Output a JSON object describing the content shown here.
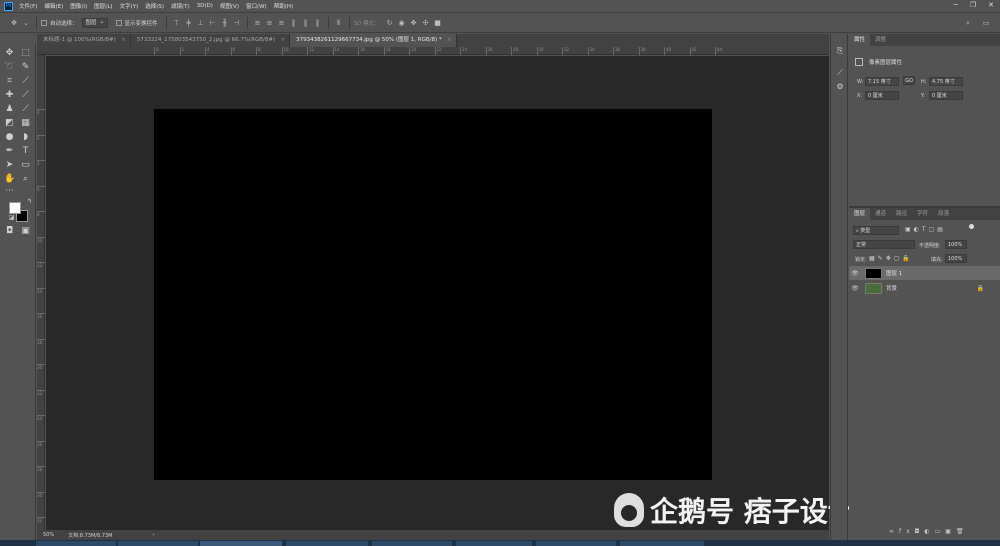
{
  "menubar": {
    "logo": "Ps",
    "items": [
      "文件(F)",
      "编辑(E)",
      "图像(I)",
      "图层(L)",
      "文字(Y)",
      "选择(S)",
      "滤镜(T)",
      "3D(D)",
      "视图(V)",
      "窗口(W)",
      "帮助(H)"
    ]
  },
  "options": {
    "auto_select_label": "自动选择：",
    "auto_select_value": "图层",
    "show_transform_label": "显示变换控件",
    "mode_3d_label": "3D 模式："
  },
  "tabs": [
    {
      "label": "未标题-1 @ 100%(RGB/8#)"
    },
    {
      "label": "5733224_175803543750_2.jpg @ 66.7%(RGB/8#)"
    },
    {
      "label": "3793438261129667734.jpg @ 50% (图层 1, RGB/8) *"
    }
  ],
  "ruler": {
    "top": [
      "0",
      "2",
      "4",
      "6",
      "8",
      "10",
      "12",
      "14",
      "16",
      "18",
      "20",
      "22",
      "24",
      "26",
      "28",
      "30",
      "32",
      "34",
      "36",
      "38",
      "40",
      "42",
      "44"
    ],
    "left": [
      "0",
      "2",
      "4",
      "6",
      "8",
      "10",
      "12",
      "14",
      "16",
      "18",
      "20",
      "22",
      "24",
      "26",
      "28",
      "30",
      "32"
    ]
  },
  "status": {
    "zoom": "50%",
    "doc": "文档:8.73M/8.73M"
  },
  "properties": {
    "tabs": [
      "属性",
      "调整"
    ],
    "title": "像素图层属性",
    "w_label": "W:",
    "w_value": "7.15 英寸",
    "h_label": "H:",
    "h_value": "4.75 英寸",
    "x_label": "X:",
    "x_value": "0 厘米",
    "y_label": "Y:",
    "y_value": "0 厘米",
    "link_label": "GO"
  },
  "layers_panel": {
    "tabs": [
      "图层",
      "通道",
      "路径",
      "字符",
      "段落"
    ],
    "filter": "类型",
    "blend": "正常",
    "opacity_label": "不透明度:",
    "opacity_value": "100%",
    "lock_label": "锁定:",
    "fill_label": "填充:",
    "fill_value": "100%",
    "layers": [
      {
        "name": "图层 1",
        "thumb_color": "#000000",
        "selected": true
      },
      {
        "name": "背景",
        "thumb_color": "#4a6b3a",
        "selected": false
      }
    ]
  },
  "watermark": {
    "text": "企鹅号 痞子设计技巧"
  },
  "colors": {
    "accent": "#31a8ff",
    "canvas": "#282828",
    "document": "#000000"
  }
}
